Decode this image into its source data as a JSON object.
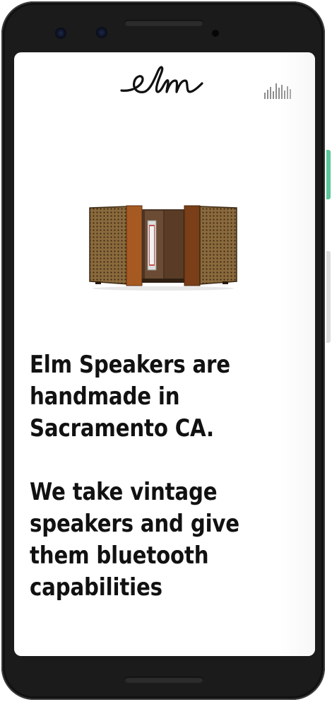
{
  "brand": {
    "logo_text": "elm"
  },
  "header": {
    "menu_icon": "equalizer-bars-icon"
  },
  "hero": {
    "image_alt": "Vintage wood speaker cabinet with cane grilles",
    "paragraphs": [
      "Elm Speakers are handmade in Sacramento CA.",
      "We take vintage speakers and give them bluetooth capabilities"
    ]
  },
  "colors": {
    "text": "#111111",
    "background": "#ffffff",
    "phone_frame": "#1b1b1b",
    "side_button": "#5cc79a"
  }
}
